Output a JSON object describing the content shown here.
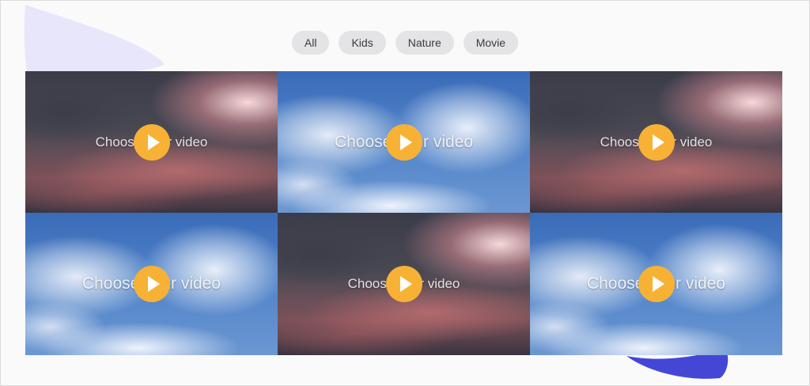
{
  "filters": [
    "All",
    "Kids",
    "Nature",
    "Movie"
  ],
  "colors": {
    "accent_play": "#f7b236",
    "blob_top": "#e8e6fa",
    "blob_bottom": "#4447d6",
    "filter_bg": "#e4e4e6"
  },
  "gallery": {
    "items": [
      {
        "caption": "Choose your video",
        "scene": "storm",
        "icon": "play-icon"
      },
      {
        "caption": "Choose your video",
        "scene": "sky",
        "icon": "play-icon"
      },
      {
        "caption": "Choose your video",
        "scene": "storm",
        "icon": "play-icon"
      },
      {
        "caption": "Choose your video",
        "scene": "sky",
        "icon": "play-icon"
      },
      {
        "caption": "Choose your video",
        "scene": "storm",
        "icon": "play-icon"
      },
      {
        "caption": "Choose your video",
        "scene": "sky",
        "icon": "play-icon"
      }
    ]
  }
}
